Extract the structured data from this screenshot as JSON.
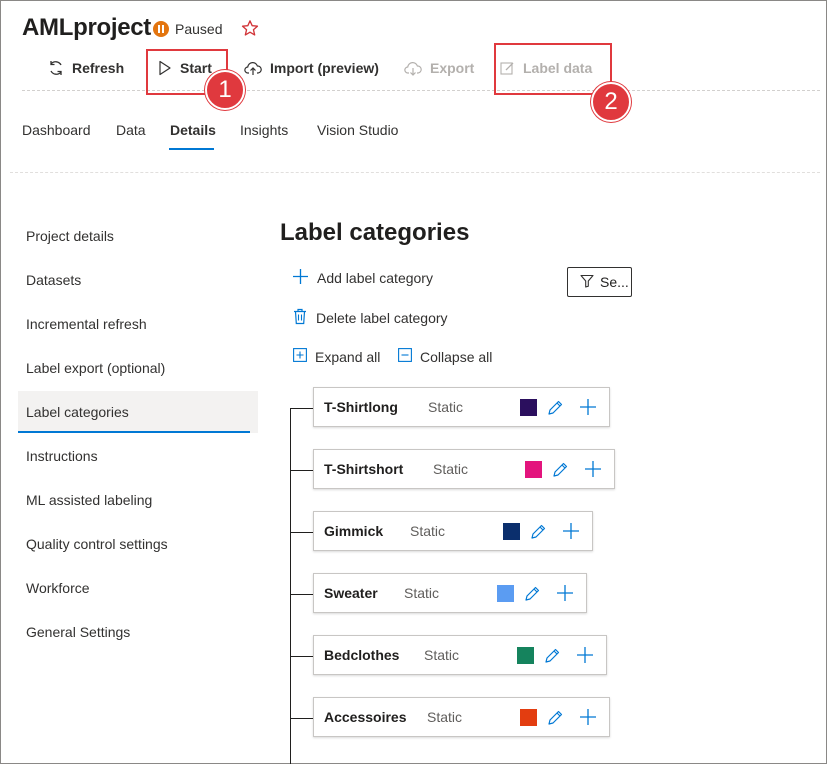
{
  "header": {
    "project_name": "AMLproject",
    "status": "Paused"
  },
  "toolbar": {
    "refresh": "Refresh",
    "start": "Start",
    "import": "Import (preview)",
    "export": "Export",
    "label_data": "Label data"
  },
  "callouts": {
    "one": "1",
    "two": "2"
  },
  "tabs": [
    "Dashboard",
    "Data",
    "Details",
    "Insights",
    "Vision Studio"
  ],
  "active_tab": "Details",
  "sidebar": {
    "items": [
      "Project details",
      "Datasets",
      "Incremental refresh",
      "Label export (optional)",
      "Label categories",
      "Instructions",
      "ML assisted labeling",
      "Quality control settings",
      "Workforce",
      "General Settings"
    ],
    "active": "Label categories"
  },
  "main": {
    "title": "Label categories",
    "add_category": "Add label category",
    "delete_category": "Delete label category",
    "expand_all": "Expand all",
    "collapse_all": "Collapse all",
    "search_label": "Se..."
  },
  "categories": [
    {
      "name": "T-Shirtlong",
      "type": "Static",
      "color": "#2b0f5e"
    },
    {
      "name": "T-Shirtshort",
      "type": "Static",
      "color": "#e3147d"
    },
    {
      "name": "Gimmick",
      "type": "Static",
      "color": "#0b2f6d"
    },
    {
      "name": "Sweater",
      "type": "Static",
      "color": "#5b9cf2"
    },
    {
      "name": "Bedclothes",
      "type": "Static",
      "color": "#15835d"
    },
    {
      "name": "Accessoires",
      "type": "Static",
      "color": "#e33d10"
    }
  ],
  "colors": {
    "accent": "#0078d4",
    "callout": "#e0393e",
    "paused": "#e3750f"
  }
}
